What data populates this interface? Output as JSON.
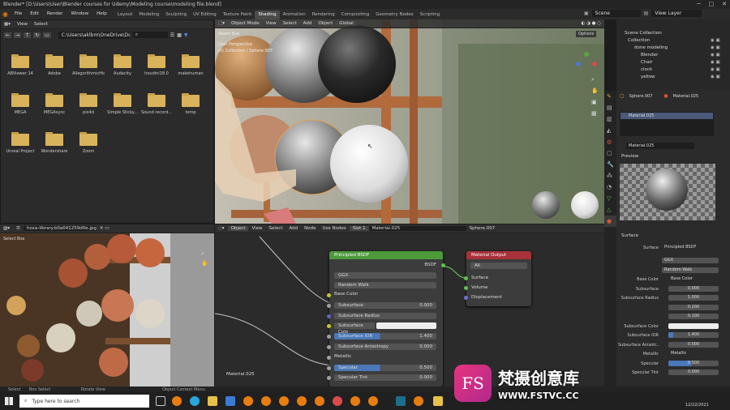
{
  "window": {
    "title": "Blender* [D:\\Users\\User\\Blender courses for Udemy\\Modeling course\\modeling file.blend]"
  },
  "topbar": {
    "menus": [
      "File",
      "Edit",
      "Render",
      "Window",
      "Help"
    ],
    "workspaces": [
      "Layout",
      "Modeling",
      "Sculpting",
      "UV Editing",
      "Texture Paint",
      "Shading",
      "Animation",
      "Rendering",
      "Compositing",
      "Geometry Nodes",
      "Scripting"
    ],
    "active_workspace": "Shading",
    "scene": "Scene",
    "view_layer": "View Layer"
  },
  "filebrowser": {
    "header": [
      "View",
      "Select"
    ],
    "path": "C:\\Users\\aklbm\\OneDrive\\Docume...",
    "folders": [
      "ABViewer 14",
      "Adobe",
      "AllegorithmicHidden",
      "Audacity",
      "houdini18.0",
      "makehuman",
      "MEGA",
      "MEGAsync",
      "pix4d",
      "Simple Sticky...",
      "Sound record...",
      "temp",
      "Unreal Project",
      "Wondershare",
      "Zoom"
    ]
  },
  "viewport": {
    "mode": "Object Mode",
    "menus": [
      "View",
      "Select",
      "Add",
      "Object"
    ],
    "orientation": "Global",
    "options": "Options",
    "perspective": "User Perspective",
    "collection": "(0) Collection | Sphere.007",
    "select_box": "Select Box"
  },
  "imageeditor": {
    "filename": "hoxa-library.b0a041259d0e.jpg",
    "select_box": "Select Box"
  },
  "nodeeditor": {
    "object": "Object",
    "menus": [
      "View",
      "Select",
      "Add",
      "Node"
    ],
    "use_nodes": "Use Nodes",
    "slot": "Slot 1",
    "material": "Material.025",
    "object_name": "Sphere.007",
    "footer_material": "Material.025",
    "bsdf": {
      "title": "Principled BSDF",
      "output": "BSDF",
      "distribution": "GGX",
      "sss_method": "Random Walk",
      "rows": [
        {
          "label": "Base Color"
        },
        {
          "label": "Subsurface",
          "value": "0.000"
        },
        {
          "label": "Subsurface Radius"
        },
        {
          "label": "Subsurface Colo"
        },
        {
          "label": "Subsurface IOR",
          "value": "1.400"
        },
        {
          "label": "Subsurface Anisotropy",
          "value": "0.000"
        },
        {
          "label": "Metallic"
        },
        {
          "label": "Specular",
          "value": "0.500"
        },
        {
          "label": "Specular Tint",
          "value": "0.000"
        }
      ]
    },
    "output": {
      "title": "Material Output",
      "target": "All",
      "sockets": [
        "Surface",
        "Volume",
        "Displacement"
      ]
    }
  },
  "outliner": {
    "root": "Scene Collection",
    "items": [
      "Collection",
      "done modeling",
      "Blender",
      "Chair",
      "clock",
      "yellow"
    ]
  },
  "properties": {
    "object": "Sphere.007",
    "material": "Material.025",
    "slot": "Material.025",
    "field": "Material.025",
    "preview": "Preview",
    "surface_section": "Surface",
    "surface_value": "Principled BSDF",
    "distribution": "GGX",
    "sss_method": "Random Walk",
    "rows": [
      {
        "label": "Base Color",
        "value": "Base Color"
      },
      {
        "label": "Subsurface",
        "value": "0.000"
      },
      {
        "label": "Subsurface Radius",
        "value": "1.000"
      },
      {
        "label": "",
        "value": "0.200"
      },
      {
        "label": "",
        "value": "0.100"
      },
      {
        "label": "Subsurface Color",
        "value": ""
      },
      {
        "label": "Subsurface IOR",
        "value": "1.400"
      },
      {
        "label": "Subsurface Anisotr...",
        "value": "0.000"
      },
      {
        "label": "Metallic",
        "value": "Metallic"
      },
      {
        "label": "Specular",
        "value": "0.500"
      },
      {
        "label": "Specular Tint",
        "value": "0.000"
      }
    ],
    "surface_label": "Surface"
  },
  "statusbar": {
    "items": [
      "Select",
      "Box Select",
      "Rotate View",
      "Object Context Menu"
    ]
  },
  "taskbar": {
    "search": "Type here to search",
    "date": "12/22/2021"
  },
  "watermark": {
    "brand": "梵摄创意库",
    "url": "WWW.FSTVC.CC",
    "logo": "FS"
  }
}
